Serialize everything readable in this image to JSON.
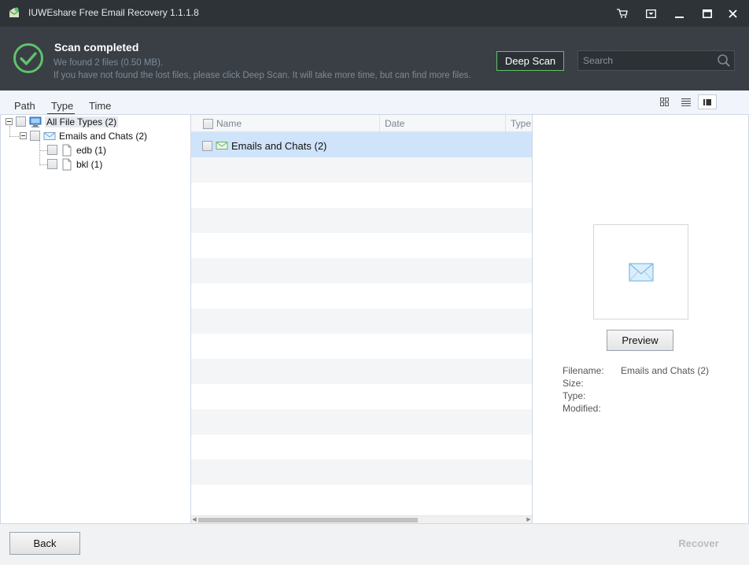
{
  "window": {
    "title": "IUWEshare Free Email Recovery 1.1.1.8",
    "controls": [
      "cart-icon",
      "menu-icon",
      "minimize-icon",
      "maximize-icon",
      "close-icon"
    ]
  },
  "header": {
    "status_title": "Scan completed",
    "found_text": "We found 2 files (0.50 MB).",
    "hint_text": "If you have not found the lost files, please click Deep Scan. It will take more time, but can find more files.",
    "deep_scan_label": "Deep Scan",
    "search_placeholder": "Search",
    "accent_color": "#5fc36a"
  },
  "tabs": [
    {
      "label": "Path",
      "active": false
    },
    {
      "label": "Type",
      "active": true
    },
    {
      "label": "Time",
      "active": false
    }
  ],
  "view_modes": [
    {
      "icon": "grid-view-icon",
      "active": false
    },
    {
      "icon": "list-view-icon",
      "active": false
    },
    {
      "icon": "detail-view-icon",
      "active": true
    }
  ],
  "tree": {
    "root": {
      "label": "All File Types (2)",
      "icon": "computer-icon"
    },
    "group": {
      "label": "Emails and Chats (2)",
      "icon": "envelope-icon"
    },
    "children": [
      {
        "label": "edb (1)",
        "icon": "file-icon"
      },
      {
        "label": "bkl (1)",
        "icon": "file-icon"
      }
    ]
  },
  "list": {
    "columns": [
      "Name",
      "Date",
      "Type"
    ],
    "rows": [
      {
        "name": "Emails and Chats (2)",
        "icon": "envelope-icon",
        "selected": true
      }
    ]
  },
  "preview": {
    "button_label": "Preview",
    "fields": [
      {
        "key": "Filename:",
        "value": "Emails and Chats (2)"
      },
      {
        "key": "Size:",
        "value": ""
      },
      {
        "key": "Type:",
        "value": ""
      },
      {
        "key": "Modified:",
        "value": ""
      }
    ]
  },
  "footer": {
    "back_label": "Back",
    "recover_label": "Recover"
  }
}
